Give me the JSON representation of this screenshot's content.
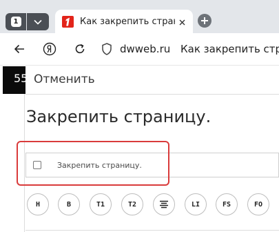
{
  "browser": {
    "tab_count": "1",
    "active_tab": {
      "title": "Как закрепить страни"
    },
    "address": {
      "domain": "dwweb.ru",
      "page_heading": "Как закрепить стран"
    },
    "icons": {
      "dropdown": "chevron-down-icon",
      "close": "close-icon",
      "new_tab": "plus-icon",
      "back": "arrow-left-icon",
      "yandex": "yandex-logo-icon",
      "reload": "reload-icon",
      "security": "shield-icon"
    }
  },
  "page": {
    "edge_text": "55",
    "cancel_label": "Отменить",
    "title": "Закрепить страницу.",
    "checkbox_label": "Закрепить страницу.",
    "format_buttons": [
      "H",
      "B",
      "T1",
      "T2",
      "",
      "LI",
      "FS",
      "FO"
    ]
  },
  "colors": {
    "tabstrip_bg": "#e3e6ea",
    "highlight_border": "#d93a3a",
    "favicon_red": "#e2241a"
  }
}
